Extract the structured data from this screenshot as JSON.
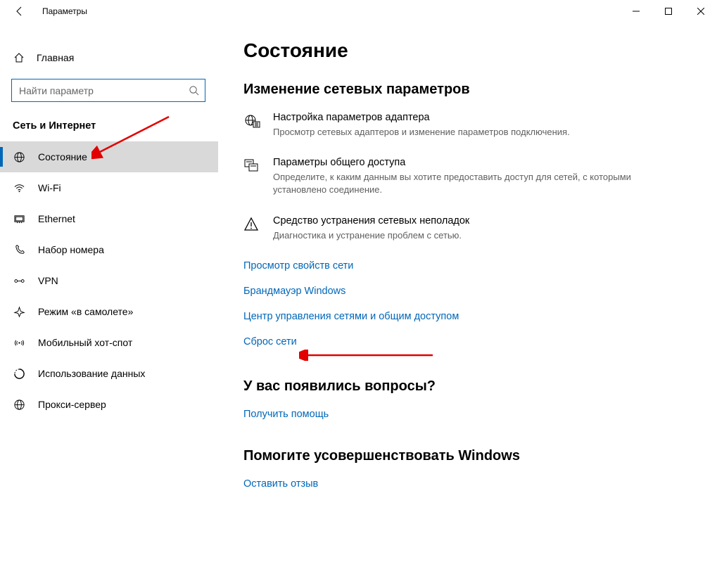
{
  "window": {
    "title": "Параметры"
  },
  "sidebar": {
    "home_label": "Главная",
    "search_placeholder": "Найти параметр",
    "section_title": "Сеть и Интернет",
    "items": [
      {
        "label": "Состояние",
        "selected": true
      },
      {
        "label": "Wi-Fi",
        "selected": false
      },
      {
        "label": "Ethernet",
        "selected": false
      },
      {
        "label": "Набор номера",
        "selected": false
      },
      {
        "label": "VPN",
        "selected": false
      },
      {
        "label": "Режим «в самолете»",
        "selected": false
      },
      {
        "label": "Мобильный хот-спот",
        "selected": false
      },
      {
        "label": "Использование данных",
        "selected": false
      },
      {
        "label": "Прокси-сервер",
        "selected": false
      }
    ]
  },
  "content": {
    "page_title": "Состояние",
    "subheading": "Изменение сетевых параметров",
    "rows": [
      {
        "title": "Настройка параметров адаптера",
        "desc": "Просмотр сетевых адаптеров и изменение параметров подключения."
      },
      {
        "title": "Параметры общего доступа",
        "desc": "Определите, к каким данным вы хотите предоставить доступ для сетей, с которыми установлено соединение."
      },
      {
        "title": "Средство устранения сетевых неполадок",
        "desc": "Диагностика и устранение проблем с сетью."
      }
    ],
    "links": [
      "Просмотр свойств сети",
      "Брандмауэр Windows",
      "Центр управления сетями и общим доступом",
      "Сброс сети"
    ],
    "questions_heading": "У вас появились вопросы?",
    "get_help": "Получить помощь",
    "feedback_heading": "Помогите усовершенствовать Windows",
    "leave_feedback": "Оставить отзыв"
  }
}
